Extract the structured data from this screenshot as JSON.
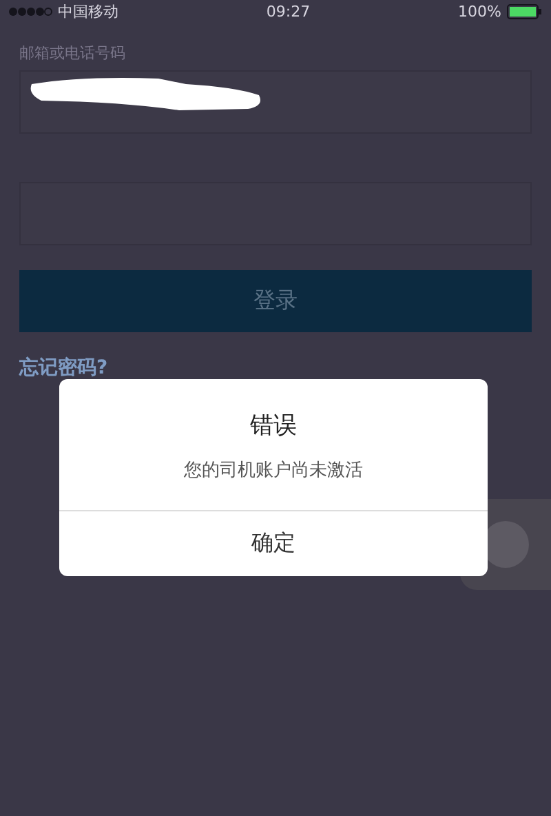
{
  "status_bar": {
    "carrier": "中国移动",
    "time": "09:27",
    "battery": "100%"
  },
  "form": {
    "account_label": "邮箱或电话号码",
    "login_button": "登录",
    "forgot_link": "忘记密码?"
  },
  "dialog": {
    "title": "错误",
    "message": "您的司机账户尚未激活",
    "buttons": [
      "确定"
    ]
  }
}
